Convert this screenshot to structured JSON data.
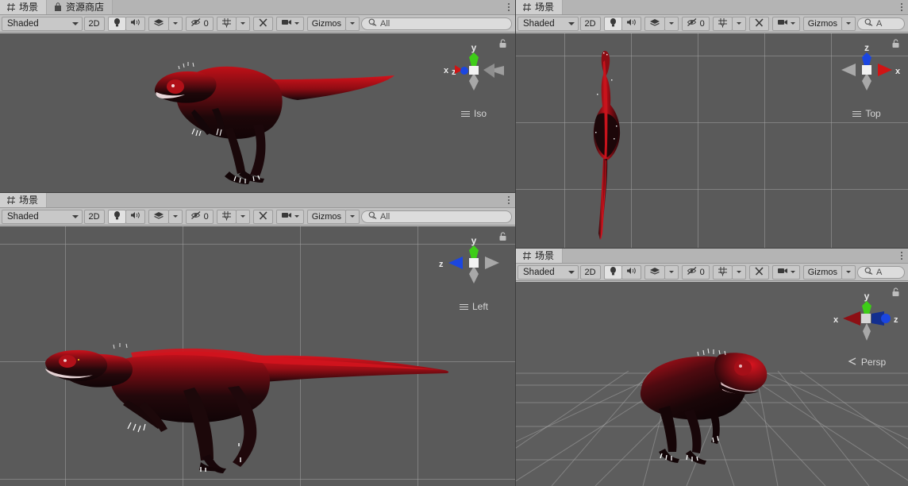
{
  "app": {
    "theme_bg": "#3f3f3f",
    "panel_bg": "#c2c2c2",
    "viewport_bg": "#5d5d5d"
  },
  "tabs": {
    "scene_label": "场景",
    "asset_store_label": "资源商店",
    "scene_icon": "grid-icon",
    "asset_store_icon": "shopping-bag-icon"
  },
  "toolbar": {
    "shading_label": "Shaded",
    "mode_2d_label": "2D",
    "lighting_icon": "lightbulb-icon",
    "audio_icon": "speaker-icon",
    "fx_icon": "effects-layers-icon",
    "hidden_count": "0",
    "hidden_icon": "eye-slash-icon",
    "grid_icon": "grid-snap-icon",
    "tools_icon": "tools-icon",
    "camera_icon": "camera-icon",
    "gizmos_label": "Gizmos",
    "search_value": "All",
    "search_value_clipped": "A",
    "search_icon": "search-icon"
  },
  "panels": [
    {
      "id": "scene-iso",
      "gizmo_label": "Iso",
      "axis_labels": {
        "up": "y",
        "left1": "x",
        "left2": "z"
      },
      "projection": "isometric",
      "content": "red-black-theropod-dinosaur-model"
    },
    {
      "id": "scene-top",
      "gizmo_label": "Top",
      "axis_labels": {
        "up": "z",
        "right": "x"
      },
      "projection": "orthographic-top",
      "content": "red-black-theropod-dinosaur-model-top-down"
    },
    {
      "id": "scene-left",
      "gizmo_label": "Left",
      "axis_labels": {
        "up": "y",
        "left": "z"
      },
      "projection": "orthographic-left",
      "content": "red-black-theropod-dinosaur-model-side"
    },
    {
      "id": "scene-persp",
      "gizmo_label": "Persp",
      "axis_labels": {
        "up": "y",
        "left": "x",
        "right": "z"
      },
      "projection": "perspective",
      "content": "red-black-theropod-dinosaur-model-perspective"
    }
  ],
  "colors": {
    "axis_x": "#d01414",
    "axis_y": "#3ecc18",
    "axis_z": "#1b46e0",
    "axis_neutral": "#a8a8a8",
    "model_primary": "#c8101a",
    "model_shadow": "#140608"
  }
}
